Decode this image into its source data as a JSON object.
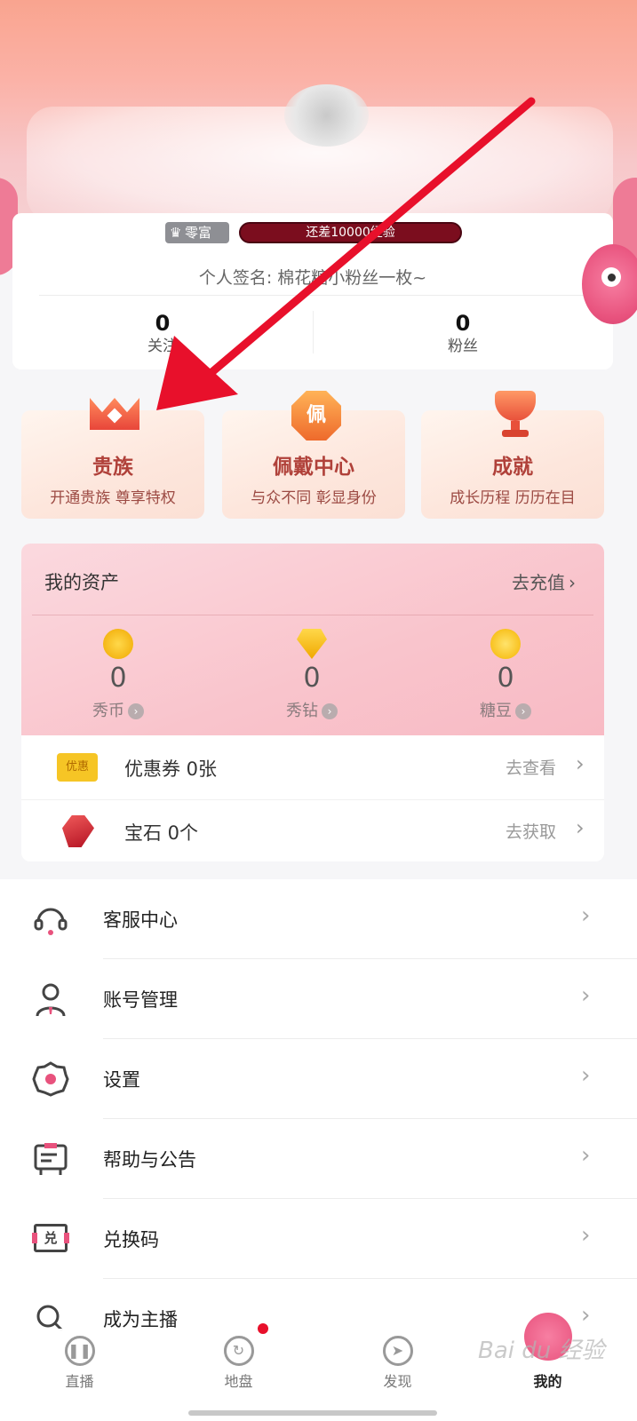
{
  "profile": {
    "level_badge": "零富",
    "exp_text": "还差10000经验",
    "signature": "个人签名: 棉花糖小粉丝一枚~",
    "stats": [
      {
        "value": "0",
        "label": "关注"
      },
      {
        "value": "0",
        "label": "粉丝"
      }
    ]
  },
  "features": [
    {
      "title": "贵族",
      "subtitle": "开通贵族 尊享特权",
      "icon": "crown-icon"
    },
    {
      "title": "佩戴中心",
      "subtitle": "与众不同 彰显身份",
      "icon": "badge-icon",
      "icon_char": "佩"
    },
    {
      "title": "成就",
      "subtitle": "成长历程 历历在目",
      "icon": "trophy-icon"
    }
  ],
  "assets": {
    "title": "我的资产",
    "recharge_label": "去充值",
    "items": [
      {
        "value": "0",
        "label": "秀币",
        "icon": "coin-icon"
      },
      {
        "value": "0",
        "label": "秀钻",
        "icon": "diamond-icon"
      },
      {
        "value": "0",
        "label": "糖豆",
        "icon": "bean-icon"
      }
    ],
    "rows": [
      {
        "label": "优惠券 0张",
        "action": "去查看",
        "icon": "coupon-icon",
        "icon_text": "优惠"
      },
      {
        "label": "宝石 0个",
        "action": "去获取",
        "icon": "gem-icon"
      }
    ]
  },
  "menu": [
    {
      "label": "客服中心",
      "icon": "headset-icon"
    },
    {
      "label": "账号管理",
      "icon": "account-icon"
    },
    {
      "label": "设置",
      "icon": "settings-icon"
    },
    {
      "label": "帮助与公告",
      "icon": "notice-icon"
    },
    {
      "label": "兑换码",
      "icon": "redeem-icon",
      "icon_text": "兑"
    },
    {
      "label": "成为主播",
      "icon": "anchor-icon"
    }
  ],
  "tabs": [
    {
      "label": "直播",
      "icon": "live-icon"
    },
    {
      "label": "地盘",
      "icon": "territory-icon"
    },
    {
      "label": "发现",
      "icon": "compass-icon"
    },
    {
      "label": "我的",
      "icon": "profile-icon"
    }
  ],
  "colors": {
    "accent": "#e8527d",
    "exp_bar": "#7b0d1e",
    "arrow": "#e8102b"
  },
  "watermark": "Bai du 经验"
}
